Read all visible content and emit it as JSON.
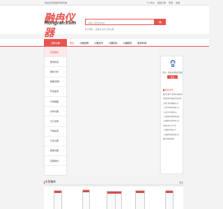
{
  "topbar": {
    "left": "欢迎您来到融冉(网)商城",
    "right": [
      "个人中心",
      "我的订单",
      "登录",
      "注册"
    ]
  },
  "logo": {
    "zh": "融冉仪器",
    "en": "Rongran.com"
  },
  "search": {
    "placeholder": "请输入搜索的商品…"
  },
  "hot_searches": "热门搜索： 显微镜  试剂  分析仪器",
  "nav": {
    "category_label": "全部仪器",
    "items": [
      "首页",
      "仪器品牌",
      "仪器资讯",
      "仪器招标",
      "仪器租赁",
      "融冉商城"
    ],
    "active": 0
  },
  "categories": [
    "实验箱体",
    "酸洗检测",
    "理化分析",
    "物理/测量",
    "环境监测",
    "不锈钢器",
    "光学仪器",
    "分子生物",
    "气体检测",
    "行业仪器",
    "其他仪器",
    "实验耗材"
  ],
  "user_panel": {
    "welcome": "您好，欢迎来到融冉商城",
    "login_label": "登录"
  },
  "news": {
    "title": "最新资讯",
    "items": [
      "融冉仪器今日更新仪器实体",
      "电动旋转/多通道分析仪器",
      "大量大型仪器招标以下",
      "上海XXX科技有限公司",
      "上海XXXX检测中心",
      "工业级别实验检测仪器",
      "上海融冉实验有限公司",
      "仪器仪表公司介绍",
      "上海融冉有限公司",
      "上海融冉科技有限公司",
      "融冉实验室网站"
    ]
  },
  "section": {
    "title": "实验箱体",
    "more": "更多"
  },
  "colors": {
    "accent": "#e8534f"
  }
}
